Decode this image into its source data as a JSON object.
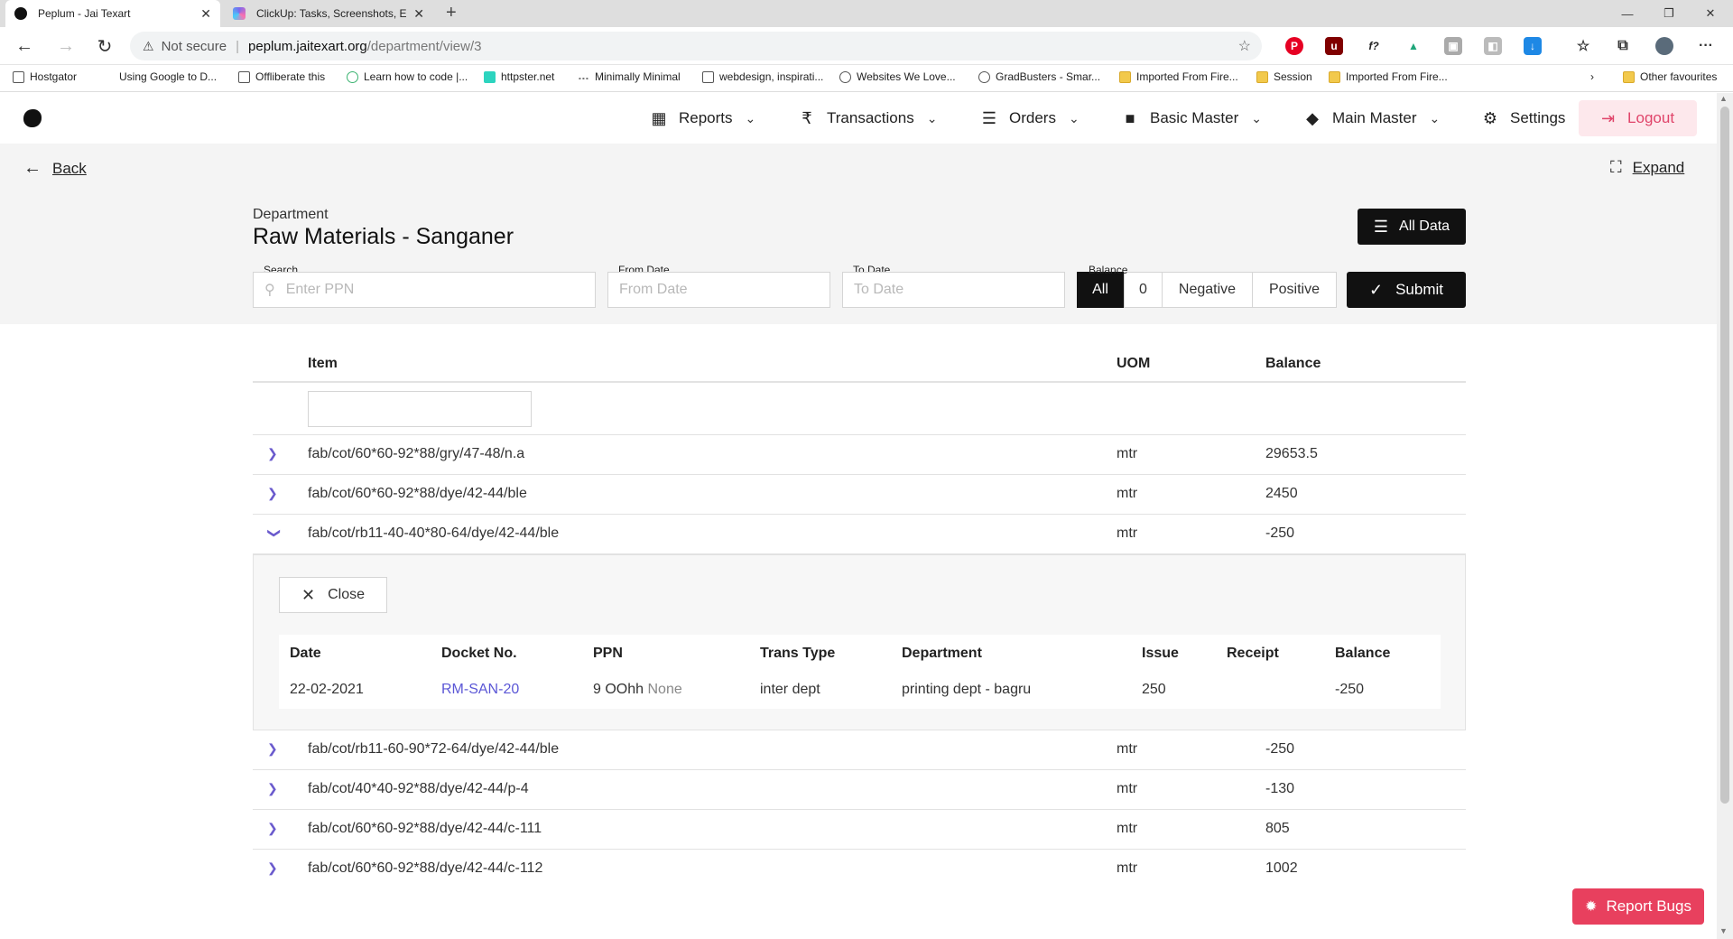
{
  "browser": {
    "tabs": [
      {
        "title": "Peplum - Jai Texart",
        "close": "✕"
      },
      {
        "title": "ClickUp: Tasks, Screenshots, Ema",
        "close": "✕"
      }
    ],
    "new_tab": "+",
    "window_controls": {
      "minimize": "—",
      "maximize": "❐",
      "close": "✕"
    },
    "nav": {
      "back": "←",
      "forward": "→",
      "reload": "↻"
    },
    "security": "Not secure",
    "url_host": "peplum.jaitexart.org",
    "url_path": "/department/view/3",
    "bookmarks": [
      "Hostgator",
      "Using Google to D...",
      "Offliberate this",
      "Learn how to code |...",
      "httpster.net",
      "Minimally Minimal",
      "webdesign, inspirati...",
      "Websites We Love...",
      "GradBusters - Smar...",
      "Imported From Fire...",
      "Session",
      "Imported From Fire..."
    ],
    "other_favourites": "Other favourites"
  },
  "header": {
    "menu": [
      {
        "label": "Reports",
        "icon": "dashboard-icon"
      },
      {
        "label": "Transactions",
        "icon": "rupee-icon"
      },
      {
        "label": "Orders",
        "icon": "order-icon"
      },
      {
        "label": "Basic Master",
        "icon": "square-icon"
      },
      {
        "label": "Main Master",
        "icon": "layers-icon"
      }
    ],
    "settings": "Settings",
    "logout": "Logout"
  },
  "subheader": {
    "back": "Back",
    "expand": "Expand",
    "dept_label": "Department",
    "dept_title": "Raw Materials - Sanganer",
    "all_data": "All Data"
  },
  "filters": {
    "search_label": "Search",
    "search_placeholder": "Enter PPN",
    "from_label": "From Date",
    "from_placeholder": "From Date",
    "to_label": "To Date",
    "to_placeholder": "To Date",
    "balance_label": "Balance",
    "balance_options": [
      "All",
      "0",
      "Negative",
      "Positive"
    ],
    "balance_selected": "All",
    "submit": "Submit"
  },
  "table": {
    "headers": {
      "item": "Item",
      "uom": "UOM",
      "balance": "Balance"
    },
    "rows": [
      {
        "item": "fab/cot/60*60-92*88/gry/47-48/n.a",
        "uom": "mtr",
        "balance": "29653.5"
      },
      {
        "item": "fab/cot/60*60-92*88/dye/42-44/ble",
        "uom": "mtr",
        "balance": "2450"
      },
      {
        "item": "fab/cot/rb11-40-40*80-64/dye/42-44/ble",
        "uom": "mtr",
        "balance": "-250"
      },
      {
        "item": "fab/cot/rb11-60-90*72-64/dye/42-44/ble",
        "uom": "mtr",
        "balance": "-250"
      },
      {
        "item": "fab/cot/40*40-92*88/dye/42-44/p-4",
        "uom": "mtr",
        "balance": "-130"
      },
      {
        "item": "fab/cot/60*60-92*88/dye/42-44/c-111",
        "uom": "mtr",
        "balance": "805"
      },
      {
        "item": "fab/cot/60*60-92*88/dye/42-44/c-112",
        "uom": "mtr",
        "balance": "1002"
      }
    ]
  },
  "detail": {
    "close": "Close",
    "headers": [
      "Date",
      "Docket No.",
      "PPN",
      "Trans Type",
      "Department",
      "Issue",
      "Receipt",
      "Balance"
    ],
    "row": {
      "date": "22-02-2021",
      "docket": "RM-SAN-20",
      "ppn": "9 OOhh",
      "ppn_suffix": "None",
      "trans_type": "inter dept",
      "department": "printing dept - bagru",
      "issue": "250",
      "receipt": "",
      "balance": "-250"
    }
  },
  "report_bugs": "Report Bugs",
  "colors": {
    "accent": "#111111",
    "logout_bg": "#fde8ec",
    "logout_fg": "#e0446a",
    "link": "#5b57d6",
    "report_bugs": "#e8405e"
  }
}
